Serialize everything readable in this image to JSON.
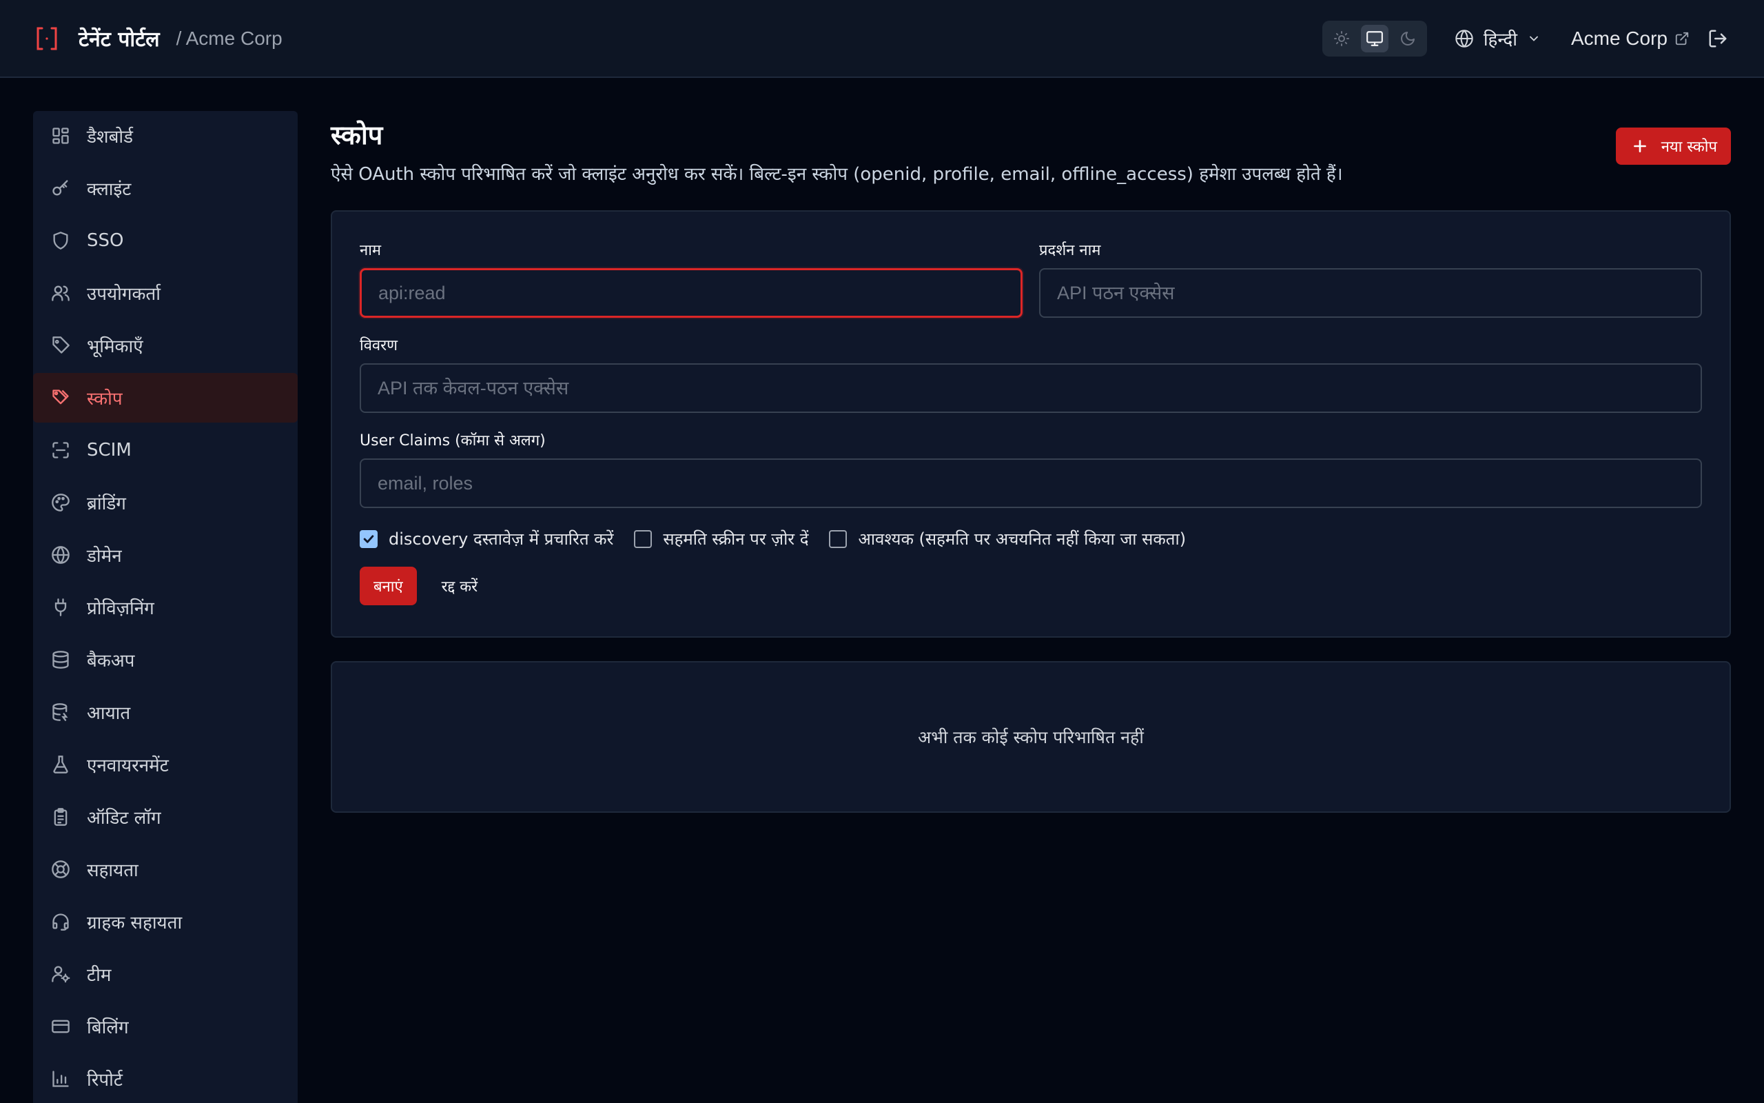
{
  "header": {
    "brand": "टेनेंट पोर्टल",
    "breadcrumb": "/ Acme Corp",
    "language": "हिन्दी",
    "tenant": "Acme Corp",
    "theme_active": "system"
  },
  "sidebar": {
    "items": [
      {
        "label": "डैशबोर्ड",
        "icon": "dashboard-icon"
      },
      {
        "label": "क्लाइंट",
        "icon": "key-icon"
      },
      {
        "label": "SSO",
        "icon": "shield-icon"
      },
      {
        "label": "उपयोगकर्ता",
        "icon": "users-icon"
      },
      {
        "label": "भूमिकाएँ",
        "icon": "tag-icon"
      },
      {
        "label": "स्कोप",
        "icon": "tags-icon",
        "active": true
      },
      {
        "label": "SCIM",
        "icon": "scan-icon"
      },
      {
        "label": "ब्रांडिंग",
        "icon": "palette-icon"
      },
      {
        "label": "डोमेन",
        "icon": "globe-icon"
      },
      {
        "label": "प्रोविज़निंग",
        "icon": "plug-icon"
      },
      {
        "label": "बैकअप",
        "icon": "database-icon"
      },
      {
        "label": "आयात",
        "icon": "database-import-icon"
      },
      {
        "label": "एनवायरनमेंट",
        "icon": "flask-icon"
      },
      {
        "label": "ऑडिट लॉग",
        "icon": "clipboard-icon"
      },
      {
        "label": "सहायता",
        "icon": "lifebuoy-icon"
      },
      {
        "label": "ग्राहक सहायता",
        "icon": "headset-icon"
      },
      {
        "label": "टीम",
        "icon": "user-cog-icon"
      },
      {
        "label": "बिलिंग",
        "icon": "credit-card-icon"
      },
      {
        "label": "रिपोर्ट",
        "icon": "chart-icon"
      }
    ]
  },
  "page": {
    "title": "स्कोप",
    "subtitle": "ऐसे OAuth स्कोप परिभाषित करें जो क्लाइंट अनुरोध कर सकें। बिल्ट-इन स्कोप (openid, profile, email, offline_access) हमेशा उपलब्ध होते हैं।",
    "new_button": "नया स्कोप"
  },
  "form": {
    "name_label": "नाम",
    "name_placeholder": "api:read",
    "display_label": "प्रदर्शन नाम",
    "display_placeholder": "API पठन एक्सेस",
    "desc_label": "विवरण",
    "desc_placeholder": "API तक केवल-पठन एक्सेस",
    "claims_label": "User Claims (कॉमा से अलग)",
    "claims_placeholder": "email, roles",
    "check_discovery": "discovery दस्तावेज़ में प्रचारित करें",
    "check_discovery_checked": true,
    "check_consent": "सहमति स्क्रीन पर ज़ोर दें",
    "check_consent_checked": false,
    "check_required": "आवश्यक (सहमति पर अचयनित नहीं किया जा सकता)",
    "check_required_checked": false,
    "create_label": "बनाएं",
    "cancel_label": "रद्द करें"
  },
  "empty": {
    "message": "अभी तक कोई स्कोप परिभाषित नहीं"
  }
}
